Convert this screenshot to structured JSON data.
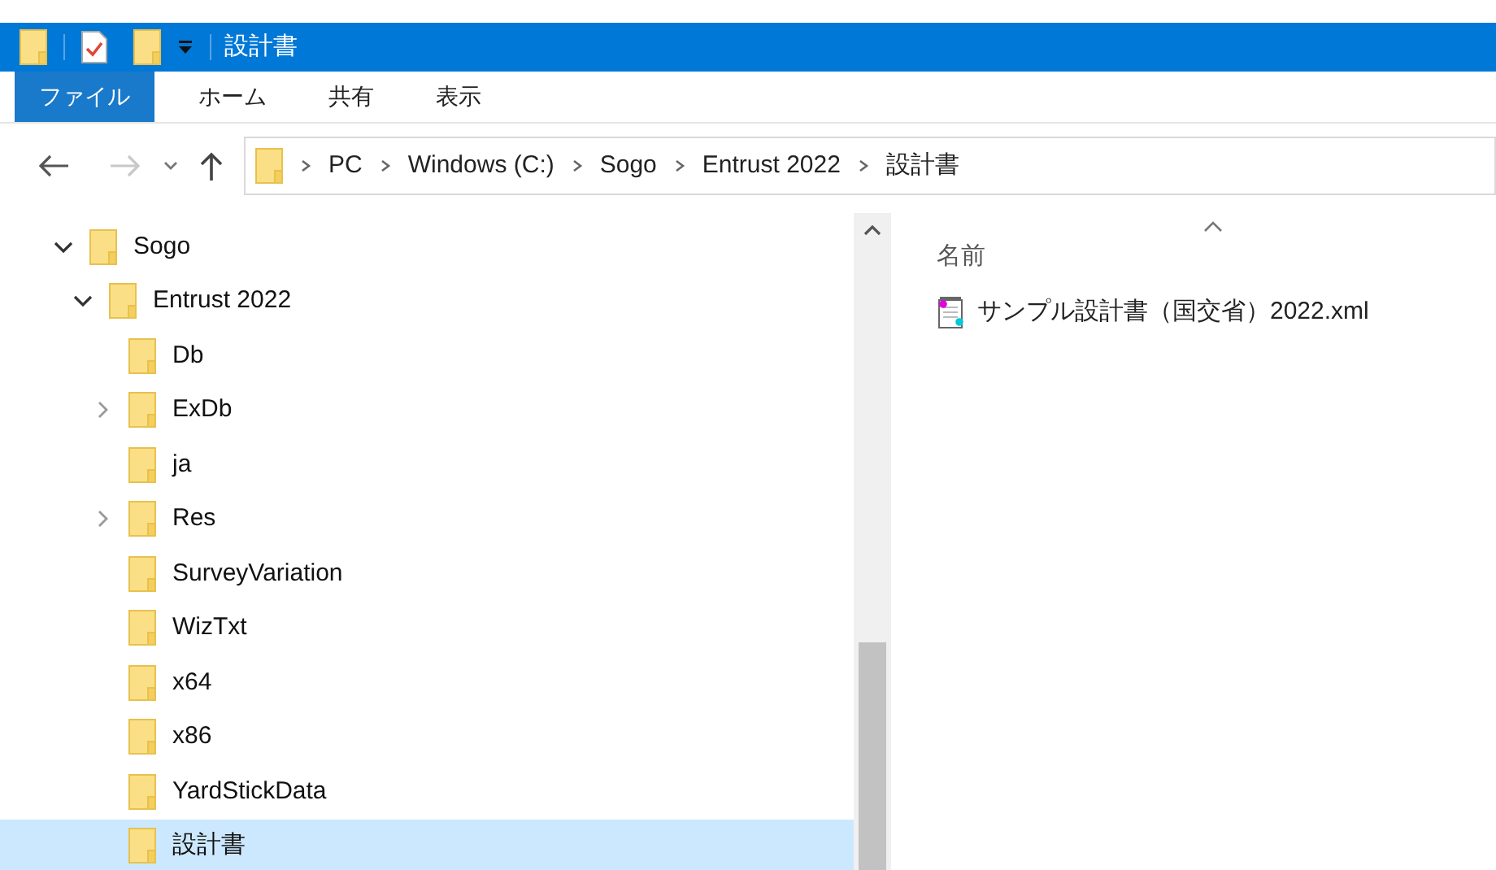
{
  "window": {
    "title": "設計書"
  },
  "ribbon_tabs": [
    {
      "label": "ファイル",
      "selected": true
    },
    {
      "label": "ホーム",
      "selected": false
    },
    {
      "label": "共有",
      "selected": false
    },
    {
      "label": "表示",
      "selected": false
    }
  ],
  "navigation": {
    "back_disabled": false,
    "forward_disabled": true
  },
  "breadcrumb": [
    "PC",
    "Windows (C:)",
    "Sogo",
    "Entrust 2022",
    "設計書"
  ],
  "tree": [
    {
      "label": "Sogo",
      "expanded": true,
      "selected": false,
      "children": [
        {
          "label": "Entrust 2022",
          "expanded": true,
          "selected": false,
          "children": [
            {
              "label": "Db",
              "selected": false
            },
            {
              "label": "ExDb",
              "expanded": false,
              "selected": false
            },
            {
              "label": "ja",
              "selected": false
            },
            {
              "label": "Res",
              "expanded": false,
              "selected": false
            },
            {
              "label": "SurveyVariation",
              "selected": false
            },
            {
              "label": "WizTxt",
              "selected": false
            },
            {
              "label": "x64",
              "selected": false
            },
            {
              "label": "x86",
              "selected": false
            },
            {
              "label": "YardStickData",
              "selected": false
            },
            {
              "label": "設計書",
              "selected": true
            }
          ]
        }
      ]
    }
  ],
  "file_list": {
    "columns": [
      {
        "label": "名前",
        "sorted": true
      }
    ],
    "files": [
      {
        "name": "サンプル設計書（国交省）2022.xml"
      }
    ]
  }
}
